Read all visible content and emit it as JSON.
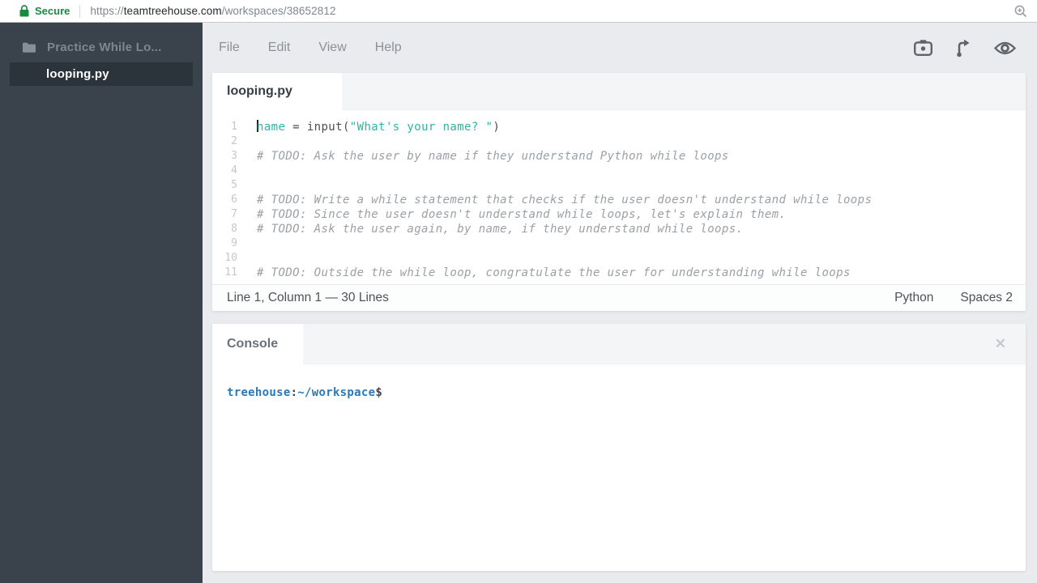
{
  "browser": {
    "security_label": "Secure",
    "url_scheme": "https://",
    "url_domain": "teamtreehouse.com",
    "url_path": "/workspaces/38652812"
  },
  "sidebar": {
    "project_name": "Practice While Lo...",
    "files": [
      {
        "name": "looping.py",
        "selected": true
      }
    ]
  },
  "menubar": {
    "items": [
      {
        "label": "File"
      },
      {
        "label": "Edit"
      },
      {
        "label": "View"
      },
      {
        "label": "Help"
      }
    ]
  },
  "toolbar": {
    "icons": [
      "camera-snapshot-icon",
      "fork-icon",
      "eye-preview-icon"
    ]
  },
  "editor": {
    "tab_label": "looping.py",
    "lines": [
      {
        "n": "1",
        "tokens": [
          {
            "t": "cursor"
          },
          {
            "t": "var",
            "text": "name"
          },
          {
            "t": "plain",
            "text": " = input("
          },
          {
            "t": "str",
            "text": "\"What's your name? \""
          },
          {
            "t": "plain",
            "text": ")"
          }
        ]
      },
      {
        "n": "2",
        "tokens": []
      },
      {
        "n": "3",
        "tokens": [
          {
            "t": "comment",
            "text": "# TODO: Ask the user by name if they understand Python while loops"
          }
        ]
      },
      {
        "n": "4",
        "tokens": []
      },
      {
        "n": "5",
        "tokens": []
      },
      {
        "n": "6",
        "tokens": [
          {
            "t": "comment",
            "text": "# TODO: Write a while statement that checks if the user doesn't understand while loops"
          }
        ]
      },
      {
        "n": "7",
        "tokens": [
          {
            "t": "comment",
            "text": "# TODO: Since the user doesn't understand while loops, let's explain them."
          }
        ]
      },
      {
        "n": "8",
        "tokens": [
          {
            "t": "comment",
            "text": "# TODO: Ask the user again, by name, if they understand while loops."
          }
        ]
      },
      {
        "n": "9",
        "tokens": []
      },
      {
        "n": "10",
        "tokens": []
      },
      {
        "n": "11",
        "tokens": [
          {
            "t": "comment",
            "text": "# TODO: Outside the while loop, congratulate the user for understanding while loops"
          }
        ]
      }
    ],
    "status_left": "Line 1, Column 1 — 30 Lines",
    "status_language": "Python",
    "status_indent": "Spaces  2"
  },
  "console": {
    "tab_label": "Console",
    "close_glyph": "✕",
    "prompt_user": "treehouse",
    "prompt_colon": ":",
    "prompt_path": "~/workspace",
    "prompt_symbol": "$"
  },
  "colors": {
    "secure_green": "#188a41",
    "sidebar_bg": "#3a424b",
    "sidebar_selected_bg": "#2b333b",
    "syntax_teal": "#2cb5a2",
    "comment_gray": "#9aa0a5",
    "prompt_blue": "#2a79b7",
    "panel_bg": "#ffffff",
    "workspace_bg": "#e9ebee"
  }
}
